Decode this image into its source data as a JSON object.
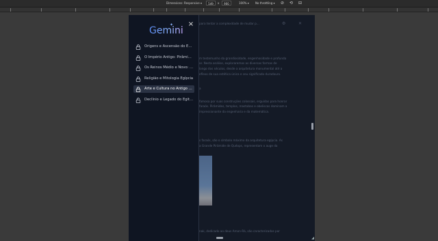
{
  "devtools_toolbar": {
    "dimensions_label": "Dimensions: Responsive",
    "width_value": "549",
    "times_symbol": "x",
    "height_value": "900",
    "zoom_value": "100%",
    "throttling_value": "No throttling"
  },
  "sidebar": {
    "logo_text": "Gemini",
    "items": [
      {
        "label": "Origens e Ascensão do Egito Antigo",
        "active": false
      },
      {
        "label": "O Império Antigo: Pirâmides e Faraós",
        "active": false
      },
      {
        "label": "Os Reinos Médio e Novo: Expansão",
        "active": false
      },
      {
        "label": "Religião e Mitologia Egípcia",
        "active": false
      },
      {
        "label": "Arte e Cultura no Antigo Egito",
        "active": true
      },
      {
        "label": "Declínio e Legado do Egito Antigo",
        "active": false
      }
    ]
  },
  "background_content": {
    "line1": "para tentar a complexidade de mudar p...",
    "para1_line1": "m testemunho da grandiosidade, engenhosidade e profunda",
    "para1_line2": "ar. Nesta análise, exploraremos as diversas formas de",
    "para1_line3": "longo dos séculos, desde a arquitetura monumental até a",
    "para1_line4": "eflexo de sua estética única e seu significado duradouro.",
    "heading2": "a",
    "para2_line1": "famosa por suas construções colossais, erguidas para honrar",
    "para2_line2": "faraós. Pirâmides, templos, mastabas e obeliscos dominam a",
    "para2_line3": "impressionante da engenharia e da matemática.",
    "para3_line1": "s faraós, são o símbolo máximo da arquitetura egípcia. As",
    "para3_line2": "a Grande Pirâmide de Quéops, representam o auge da",
    "para4_line1": "nak, dedicado ao deus Amon-Rá, são caracterizados por"
  },
  "colors": {
    "page_background": "#3a3a3a",
    "viewport_background": "#141a26",
    "sidebar_background": "#0f1522",
    "active_item": "#2a3243",
    "logo_gradient_start": "#5b8cf5",
    "logo_gradient_end": "#c6a9ff"
  }
}
